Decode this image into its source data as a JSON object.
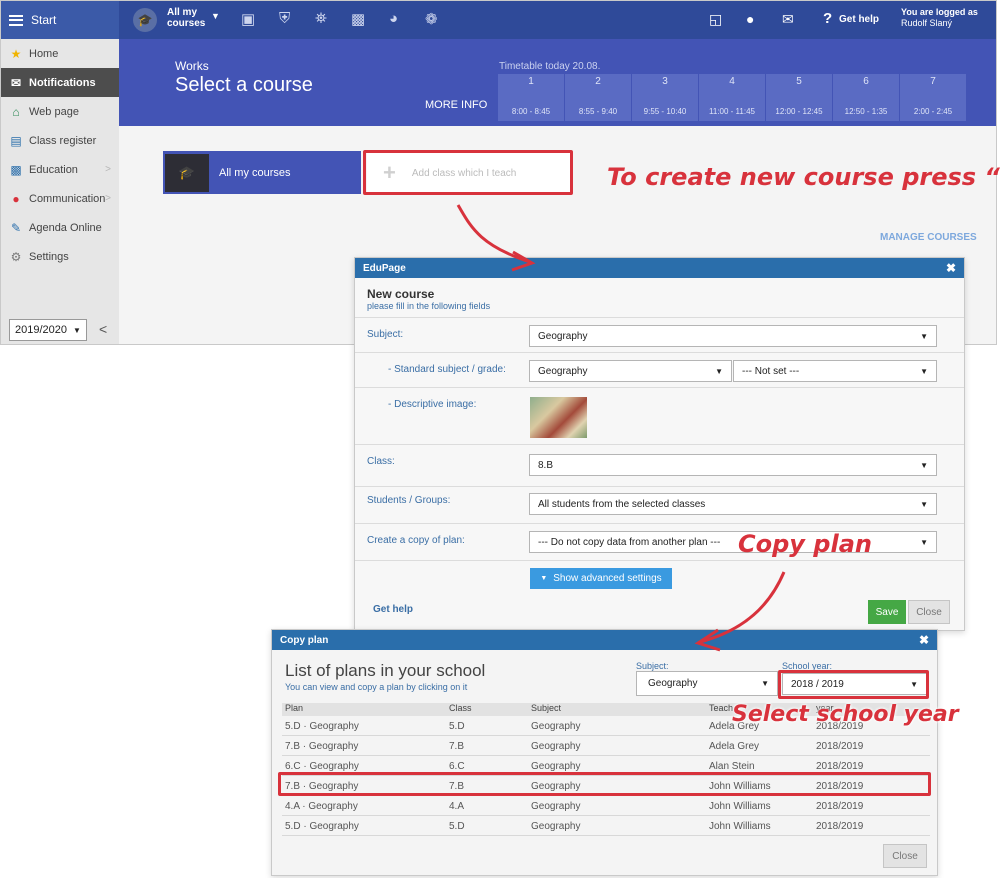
{
  "topbar": {
    "start_label": "Start",
    "courses_menu": {
      "line1": "All my",
      "line2": "courses"
    },
    "get_help": "Get help",
    "login": {
      "line1": "You are logged as",
      "user": "Rudolf Slaný"
    }
  },
  "sidebar": {
    "items": [
      {
        "label": "Home",
        "icon": "star-icon"
      },
      {
        "label": "Notifications",
        "icon": "envelope-icon",
        "active": true
      },
      {
        "label": "Web page",
        "icon": "house-icon"
      },
      {
        "label": "Class register",
        "icon": "register-icon"
      },
      {
        "label": "Education",
        "icon": "book-icon",
        "has_submenu": true
      },
      {
        "label": "Communication",
        "icon": "chat-icon",
        "has_submenu": true
      },
      {
        "label": "Agenda Online",
        "icon": "pen-icon"
      },
      {
        "label": "Settings",
        "icon": "gear-icon"
      }
    ],
    "school_year": "2019/2020"
  },
  "header": {
    "section": "Works",
    "title": "Select a course",
    "more_info": "MORE INFO",
    "timetable": {
      "title": "Timetable today 20.08.",
      "periods": [
        {
          "num": "1",
          "time": "8:00 - 8:45"
        },
        {
          "num": "2",
          "time": "8:55 - 9:40"
        },
        {
          "num": "3",
          "time": "9:55 - 10:40"
        },
        {
          "num": "4",
          "time": "11:00 - 11:45"
        },
        {
          "num": "5",
          "time": "12:00 - 12:45"
        },
        {
          "num": "6",
          "time": "12:50 - 1:35"
        },
        {
          "num": "7",
          "time": "2:00 - 2:45"
        }
      ]
    }
  },
  "courses": {
    "all_courses": "All my courses",
    "add_placeholder": "Add class which I teach",
    "manage": "MANAGE COURSES"
  },
  "new_course_dialog": {
    "header": "EduPage",
    "title": "New course",
    "subtitle": "please fill in the following fields",
    "fields": {
      "subject": {
        "label": "Subject:",
        "value": "Geography"
      },
      "standard": {
        "label": "- Standard subject / grade:",
        "value": "Geography",
        "grade": "--- Not set ---"
      },
      "image": {
        "label": "- Descriptive image:"
      },
      "class": {
        "label": "Class:",
        "value": "8.B"
      },
      "students": {
        "label": "Students / Groups:",
        "value": "All students from the selected classes"
      },
      "copy_plan": {
        "label": "Create a copy of plan:",
        "value": "--- Do not copy data from another plan ---"
      }
    },
    "advanced": "Show advanced settings",
    "get_help": "Get help",
    "save": "Save",
    "close": "Close"
  },
  "copy_plan_dialog": {
    "header": "Copy plan",
    "title": "List of plans in your school",
    "subtitle": "You can view and copy a plan by clicking on it",
    "subject_filter": {
      "label": "Subject:",
      "value": "Geography"
    },
    "year_filter": {
      "label": "School year:",
      "value": "2018 / 2019"
    },
    "columns": [
      "Plan",
      "Class",
      "Subject",
      "Teach",
      "year"
    ],
    "rows": [
      {
        "plan": "5.D · Geography",
        "class": "5.D",
        "subject": "Geography",
        "teacher": "Adela Grey",
        "year": "2018/2019"
      },
      {
        "plan": "7.B · Geography",
        "class": "7.B",
        "subject": "Geography",
        "teacher": "Adela Grey",
        "year": "2018/2019"
      },
      {
        "plan": "6.C · Geography",
        "class": "6.C",
        "subject": "Geography",
        "teacher": "Alan Stein",
        "year": "2018/2019"
      },
      {
        "plan": "7.B · Geography",
        "class": "7.B",
        "subject": "Geography",
        "teacher": "John Williams",
        "year": "2018/2019"
      },
      {
        "plan": "4.A · Geography",
        "class": "4.A",
        "subject": "Geography",
        "teacher": "John Williams",
        "year": "2018/2019"
      },
      {
        "plan": "5.D · Geography",
        "class": "5.D",
        "subject": "Geography",
        "teacher": "John Williams",
        "year": "2018/2019"
      }
    ],
    "close": "Close"
  },
  "annotations": {
    "create": "To create new course press “+”",
    "copy": "Copy plan",
    "select_year": "Select school year"
  },
  "colors": {
    "accent": "#4354b5",
    "annotation": "#d8323c",
    "dialog_header": "#2a6eab",
    "save": "#45a845"
  }
}
